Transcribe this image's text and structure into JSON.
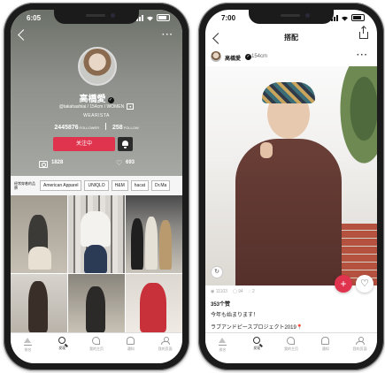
{
  "colors": {
    "accent": "#e0334e",
    "frame": "#1b1b1b"
  },
  "left": {
    "time": "6:05",
    "profile": {
      "name": "高橋愛",
      "handle": "@takahashiai / 154cm / WOMEN",
      "brand": "WEARISTA",
      "followers": "2445876",
      "followers_label": "FOLLOWER",
      "following": "258",
      "following_label": "FOLLOW",
      "follow_button": "关注中"
    },
    "counts": {
      "posts": "1828",
      "likes": "693"
    },
    "tags": [
      "经常穿着的品牌",
      "American Apparel",
      "UNIQLO",
      "H&M",
      "hacat",
      "Dr.Ma"
    ],
    "tabs": [
      {
        "label": "排名",
        "icon": "crown-icon"
      },
      {
        "label": "发现",
        "icon": "search-icon"
      },
      {
        "label": "我的主页",
        "icon": "feed-icon"
      },
      {
        "label": "通知",
        "icon": "bell-icon"
      },
      {
        "label": "我的页面",
        "icon": "person-icon"
      }
    ]
  },
  "right": {
    "time": "7:00",
    "title": "搭配",
    "user": {
      "name": "高橋愛",
      "height": "154cm"
    },
    "stats": {
      "views": "11103",
      "saves": "94",
      "comments": "2"
    },
    "likes": "353个赞",
    "caption1": "今年も始まります！",
    "caption2": "ラブアンドピースプロジェクト2019",
    "tabs": [
      {
        "label": "排名",
        "icon": "crown-icon"
      },
      {
        "label": "发现",
        "icon": "search-icon"
      },
      {
        "label": "我的主页",
        "icon": "feed-icon"
      },
      {
        "label": "通知",
        "icon": "bell-icon"
      },
      {
        "label": "我的页面",
        "icon": "person-icon"
      }
    ]
  }
}
